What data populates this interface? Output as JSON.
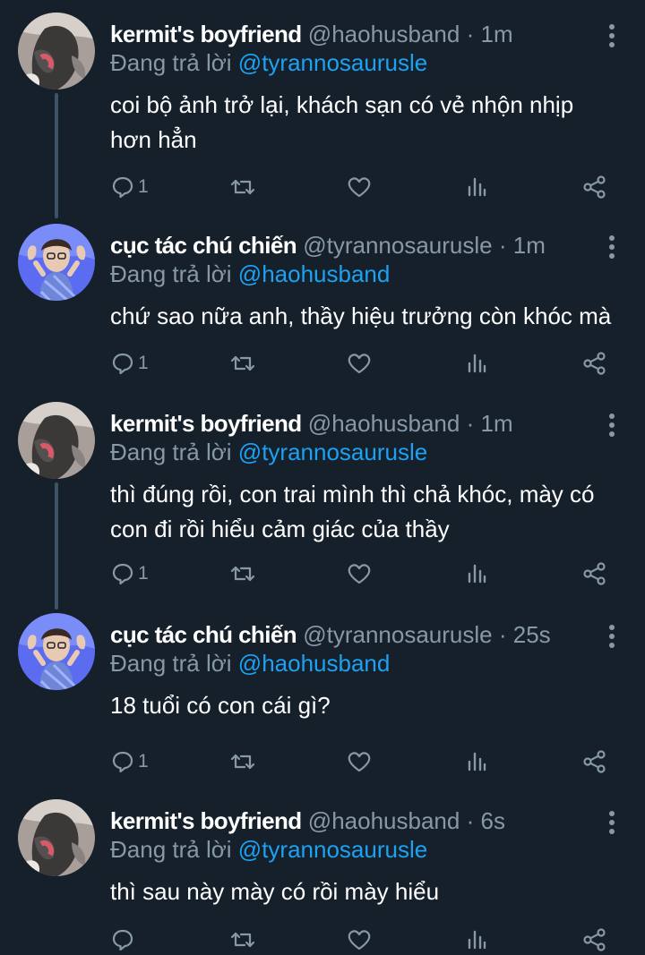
{
  "tweets": [
    {
      "name": "kermit's boyfriend",
      "handle": "@haohusband",
      "time": "1m",
      "reply_prefix": "Đang trả lời",
      "reply_to": "@tyrannosaurusle",
      "text": "coi bộ ảnh trở lại, khách sạn có vẻ nhộn nhịp hơn hẳn",
      "reply_count": "1",
      "avatar": "kermit-avatar"
    },
    {
      "name": "cục tác chú chiến",
      "handle": "@tyrannosaurusle",
      "time": "1m",
      "reply_prefix": "Đang trả lời",
      "reply_to": "@haohusband",
      "text": "chứ sao nữa anh, thầy hiệu trưởng còn khóc mà",
      "reply_count": "1",
      "avatar": "blue-avatar"
    },
    {
      "name": "kermit's boyfriend",
      "handle": "@haohusband",
      "time": "1m",
      "reply_prefix": "Đang trả lời",
      "reply_to": "@tyrannosaurusle",
      "text": "thì đúng rồi, con trai mình thì chả khóc, mày có con đi rồi hiểu cảm giác của thầy",
      "reply_count": "1",
      "avatar": "kermit-avatar"
    },
    {
      "name": "cục tác chú chiến",
      "handle": "@tyrannosaurusle",
      "time": "25s",
      "reply_prefix": "Đang trả lời",
      "reply_to": "@haohusband",
      "text": "18 tuổi có con cái gì?",
      "reply_count": "1",
      "avatar": "blue-avatar"
    },
    {
      "name": "kermit's boyfriend",
      "handle": "@haohusband",
      "time": "6s",
      "reply_prefix": "Đang trả lời",
      "reply_to": "@tyrannosaurusle",
      "text": "thì sau này mày có rồi mày hiểu",
      "reply_count": "",
      "avatar": "kermit-avatar"
    }
  ],
  "theme": {
    "background": "#15202b",
    "secondary_text": "#8899a6",
    "accent": "#1da1f2"
  }
}
